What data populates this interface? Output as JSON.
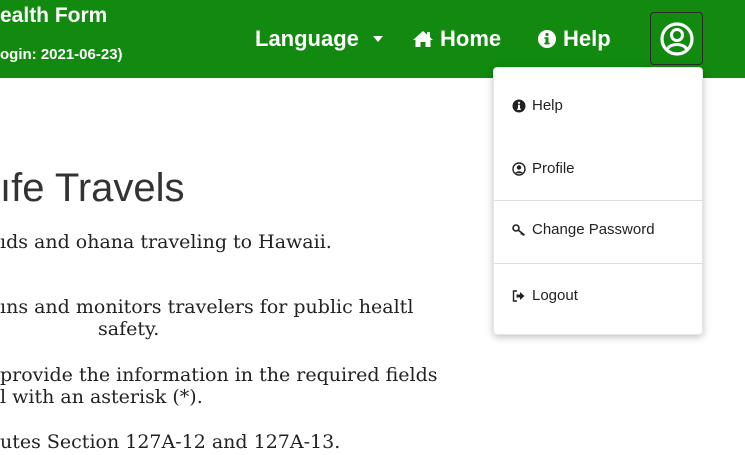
{
  "navbar": {
    "brand_title": "ealth Form",
    "brand_sub": "ogin: 2021-06-23)",
    "language_label": "Language",
    "home_label": "Home",
    "help_label": "Help",
    "user_icon": "user-circle-icon",
    "color": "#118a0f"
  },
  "content": {
    "heading": "ıfe Travels",
    "line1": "ıds and ohana traveling to Hawaii.",
    "line2": "ıns and monitors travelers for public healtl",
    "line2b": "safety.",
    "line3": "provide the information in the required fields",
    "line3b": "l with an asterisk (*).",
    "line4": "utes Section 127A-12 and 127A-13."
  },
  "dropdown": {
    "help": "Help",
    "profile": "Profile",
    "change_password": "Change Password",
    "logout": "Logout"
  }
}
